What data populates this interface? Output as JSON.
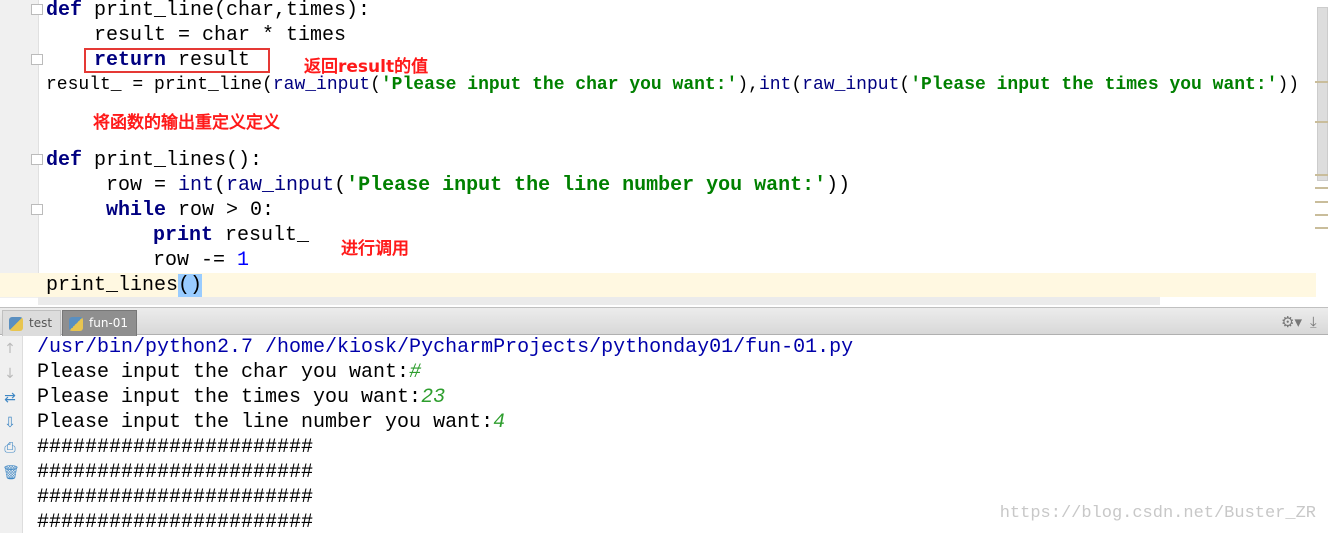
{
  "editor": {
    "lines": [
      {
        "kw": "def",
        "rest": " print_line(char,times):"
      },
      {
        "text": "result = char * times"
      },
      {
        "kw": "return",
        "rest": " result"
      },
      {
        "a": "result_ = print_line(",
        "b": "raw_input",
        "c": "(",
        "d": "'Please input the char you want:'",
        "e": "),",
        "f": "int",
        "g": "(",
        "h": "raw_input",
        "i": "(",
        "j": "'Please input the times you want:'",
        "k": "))"
      },
      {
        "kw": "def",
        "rest": " print_lines():"
      },
      {
        "a": "row = ",
        "b": "int",
        "c": "(",
        "d": "raw_input",
        "e": "(",
        "f": "'Please input the line number you want:'",
        "g": "))"
      },
      {
        "kw": "while",
        "rest": " row > 0:"
      },
      {
        "kw": "print",
        "rest": " result_"
      },
      {
        "a": "row -= ",
        "num": "1"
      },
      {
        "a": "print_lines",
        "brace": "()"
      }
    ],
    "annotations": {
      "return_note": "返回result的值",
      "redefine_note": "将函数的输出重定义定义",
      "call_note": "进行调用"
    }
  },
  "run_panel": {
    "tabs": [
      {
        "label": "test",
        "icon": "python-icon"
      },
      {
        "label": "fun-01",
        "icon": "python-icon",
        "active": true
      }
    ],
    "console": {
      "command": "/usr/bin/python2.7 /home/kiosk/PycharmProjects/pythonday01/fun-01.py",
      "prompts": [
        {
          "text": "Please input the char you want:",
          "input": "#"
        },
        {
          "text": "Please input the times you want:",
          "input": "23"
        },
        {
          "text": "Please input the line number you want:",
          "input": "4"
        }
      ],
      "output": [
        "#######################",
        "#######################",
        "#######################",
        "#######################"
      ]
    }
  },
  "watermark": "https://blog.csdn.net/Buster_ZR"
}
